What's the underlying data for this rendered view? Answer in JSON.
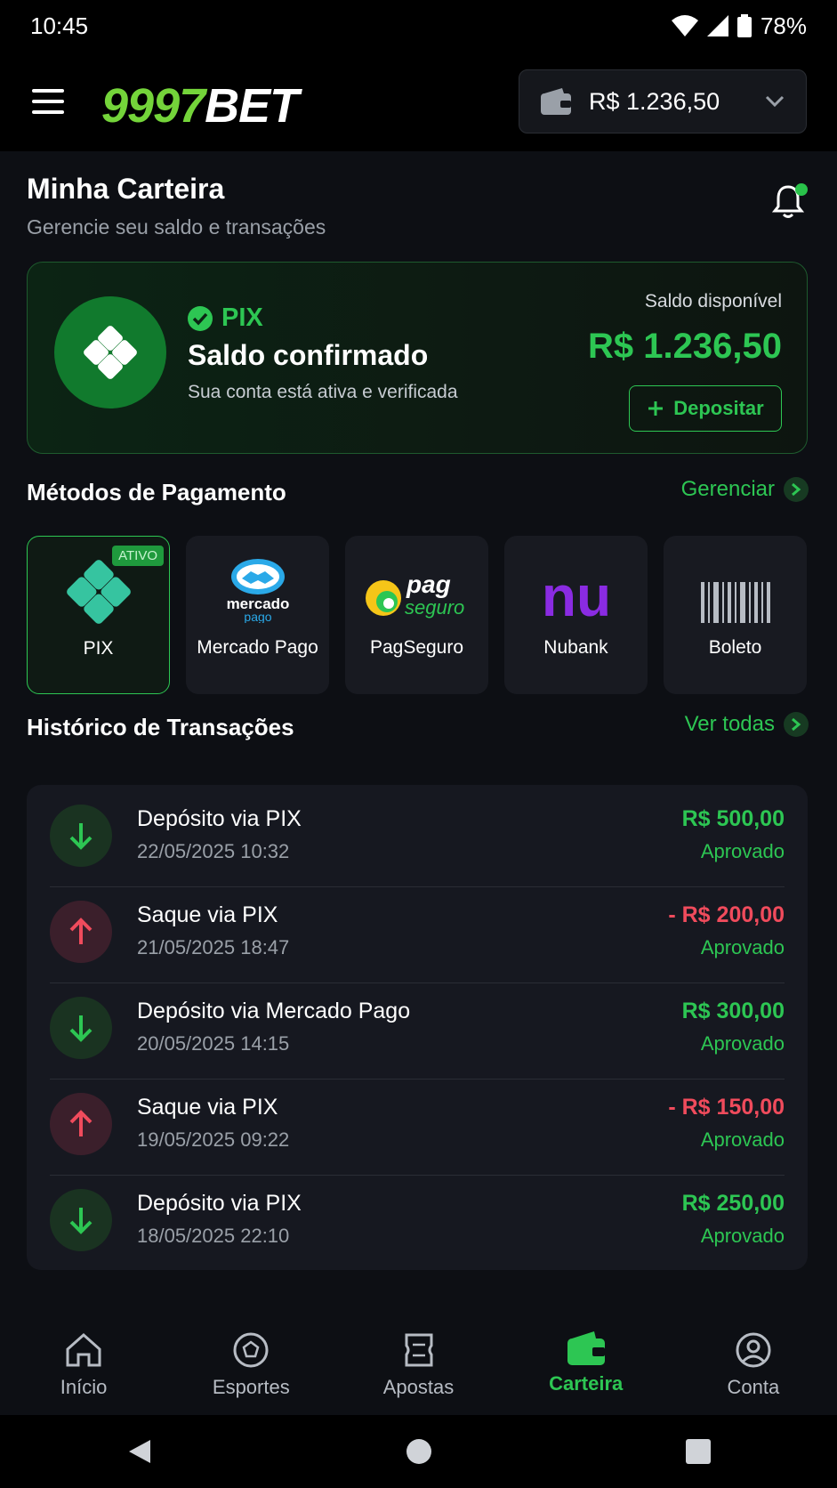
{
  "status_bar": {
    "time": "10:45",
    "battery": "78%"
  },
  "header": {
    "logo_green": "9997",
    "logo_white": "BET",
    "balance": "R$ 1.236,50"
  },
  "page": {
    "title": "Minha Carteira",
    "subtitle": "Gerencie seu saldo e transações"
  },
  "balance_card": {
    "tag": "PIX",
    "title": "Saldo confirmado",
    "subtitle": "Sua conta está ativa e verificada",
    "saldo_label": "Saldo disponível",
    "saldo_amount": "R$ 1.236,50",
    "deposit_label": "Depositar"
  },
  "payment_methods": {
    "title": "Métodos de Pagamento",
    "manage_label": "Gerenciar",
    "active_badge": "ATIVO",
    "items": [
      {
        "label": "PIX",
        "icon": "pix-icon",
        "active": true
      },
      {
        "label": "Mercado Pago",
        "icon": "mercado-pago-logo",
        "logo_text_1": "mercado",
        "logo_text_2": "pago"
      },
      {
        "label": "PagSeguro",
        "icon": "pagseguro-logo",
        "logo_text_1": "pag",
        "logo_text_2": "seguro"
      },
      {
        "label": "Nubank",
        "icon": "nubank-logo",
        "logo_text_1": "nu"
      },
      {
        "label": "Boleto",
        "icon": "barcode-icon"
      }
    ]
  },
  "transactions": {
    "title": "Histórico de Transações",
    "view_all_label": "Ver todas",
    "items": [
      {
        "title": "Depósito via PIX",
        "date": "22/05/2025 10:32",
        "amount": "R$ 500,00",
        "status": "Aprovado",
        "type": "in"
      },
      {
        "title": "Saque via PIX",
        "date": "21/05/2025 18:47",
        "amount": "- R$ 200,00",
        "status": "Aprovado",
        "type": "out"
      },
      {
        "title": "Depósito via Mercado Pago",
        "date": "20/05/2025 14:15",
        "amount": "R$ 300,00",
        "status": "Aprovado",
        "type": "in"
      },
      {
        "title": "Saque via PIX",
        "date": "19/05/2025 09:22",
        "amount": "- R$ 150,00",
        "status": "Aprovado",
        "type": "out"
      },
      {
        "title": "Depósito via PIX",
        "date": "18/05/2025 22:10",
        "amount": "R$ 250,00",
        "status": "Aprovado",
        "type": "in"
      }
    ]
  },
  "bottom_nav": {
    "items": [
      {
        "label": "Início",
        "icon": "home-icon"
      },
      {
        "label": "Esportes",
        "icon": "soccer-ball-icon"
      },
      {
        "label": "Apostas",
        "icon": "ticket-icon"
      },
      {
        "label": "Carteira",
        "icon": "wallet-icon",
        "active": true
      },
      {
        "label": "Conta",
        "icon": "user-circle-icon"
      }
    ]
  },
  "colors": {
    "accent": "#2dc653",
    "logo_green": "#74d43a",
    "negative": "#f04b5c",
    "background": "#0d0f14"
  }
}
